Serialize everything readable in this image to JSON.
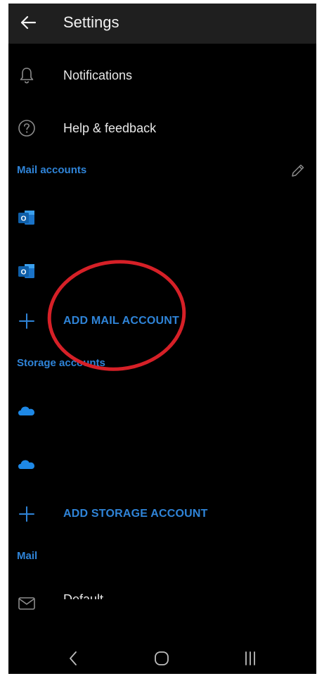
{
  "app": {
    "title": "Settings",
    "icons": {
      "back": "arrow-left-icon",
      "edit": "pencil-icon"
    }
  },
  "items": {
    "notifications": {
      "label": "Notifications",
      "icon": "bell-icon"
    },
    "help": {
      "label": "Help & feedback",
      "icon": "question-circle-icon"
    }
  },
  "sections": {
    "mail_accounts": "Mail accounts",
    "storage_accounts": "Storage accounts",
    "mail": "Mail"
  },
  "mail_accounts": [
    {
      "icon": "outlook-icon",
      "label": ""
    },
    {
      "icon": "outlook-icon",
      "label": ""
    }
  ],
  "add_mail_account": {
    "label": "ADD MAIL ACCOUNT",
    "icon": "plus-icon"
  },
  "storage_accounts": [
    {
      "icon": "onedrive-cloud-icon",
      "label": ""
    },
    {
      "icon": "onedrive-cloud-icon",
      "label": ""
    }
  ],
  "add_storage_account": {
    "label": "ADD STORAGE ACCOUNT",
    "icon": "plus-icon"
  },
  "mail_row": {
    "label": "Default...",
    "icon": "envelope-icon"
  },
  "system_nav": {
    "back": "chevron-left-icon",
    "home": "home-circle-icon",
    "recents": "recents-icon"
  },
  "colors": {
    "background": "#000000",
    "appbar": "#1f1f1f",
    "accent": "#2f84d8",
    "text": "#e8e8e8",
    "annotation": "#d62027"
  }
}
